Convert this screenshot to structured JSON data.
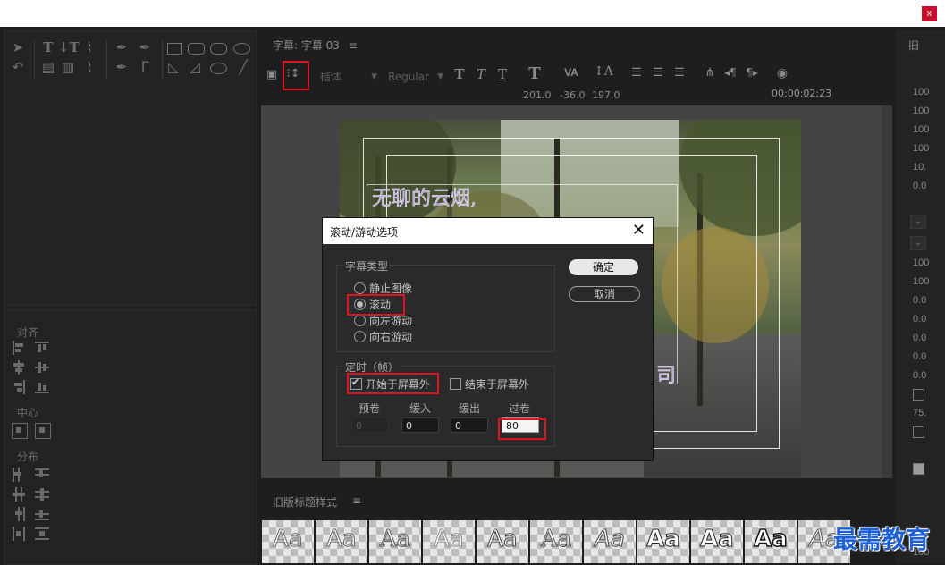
{
  "window": {
    "close_label": "x"
  },
  "editor": {
    "title": "字幕: 字幕 03",
    "menu_icon": "≡",
    "font_family": "楷体",
    "font_style": "Regular",
    "num_x": "201.0",
    "num_y": "-36.0",
    "num_z": "197.0",
    "timecode": "00:00:02:23",
    "preview_text": "无聊的云烟,",
    "preview_tail": "司"
  },
  "align_panel": {
    "align_label": "对齐",
    "center_label": "中心",
    "distribute_label": "分布"
  },
  "styles": {
    "title": "旧版标题样式",
    "menu_icon": "≡",
    "swatch_label": "Aa"
  },
  "right_panel": {
    "header": "旧",
    "values": [
      "100",
      "100",
      "100",
      "100",
      "10.",
      "0.0",
      "100",
      "100",
      "0.0",
      "0.0",
      "0.0",
      "0.0",
      "0.0",
      "75.",
      "100"
    ]
  },
  "dialog": {
    "title": "滚动/游动选项",
    "close_icon": "✕",
    "type_group_label": "字幕类型",
    "options": [
      "静止图像",
      "滚动",
      "向左游动",
      "向右游动"
    ],
    "selected_option": "滚动",
    "timing_group_label": "定时（帧）",
    "start_offscreen_label": "开始于屏幕外",
    "start_offscreen_checked": true,
    "end_offscreen_label": "结束于屏幕外",
    "end_offscreen_checked": false,
    "fields": [
      {
        "label": "预卷",
        "value": "0"
      },
      {
        "label": "缓入",
        "value": "0"
      },
      {
        "label": "缓出",
        "value": "0"
      },
      {
        "label": "过卷",
        "value": "80"
      }
    ],
    "ok_label": "确定",
    "cancel_label": "取消"
  },
  "watermark": "最需教育",
  "colors": {
    "highlight": "#e0141e",
    "watermark": "#1c5fd6",
    "preview_text": "#b79fe0"
  }
}
